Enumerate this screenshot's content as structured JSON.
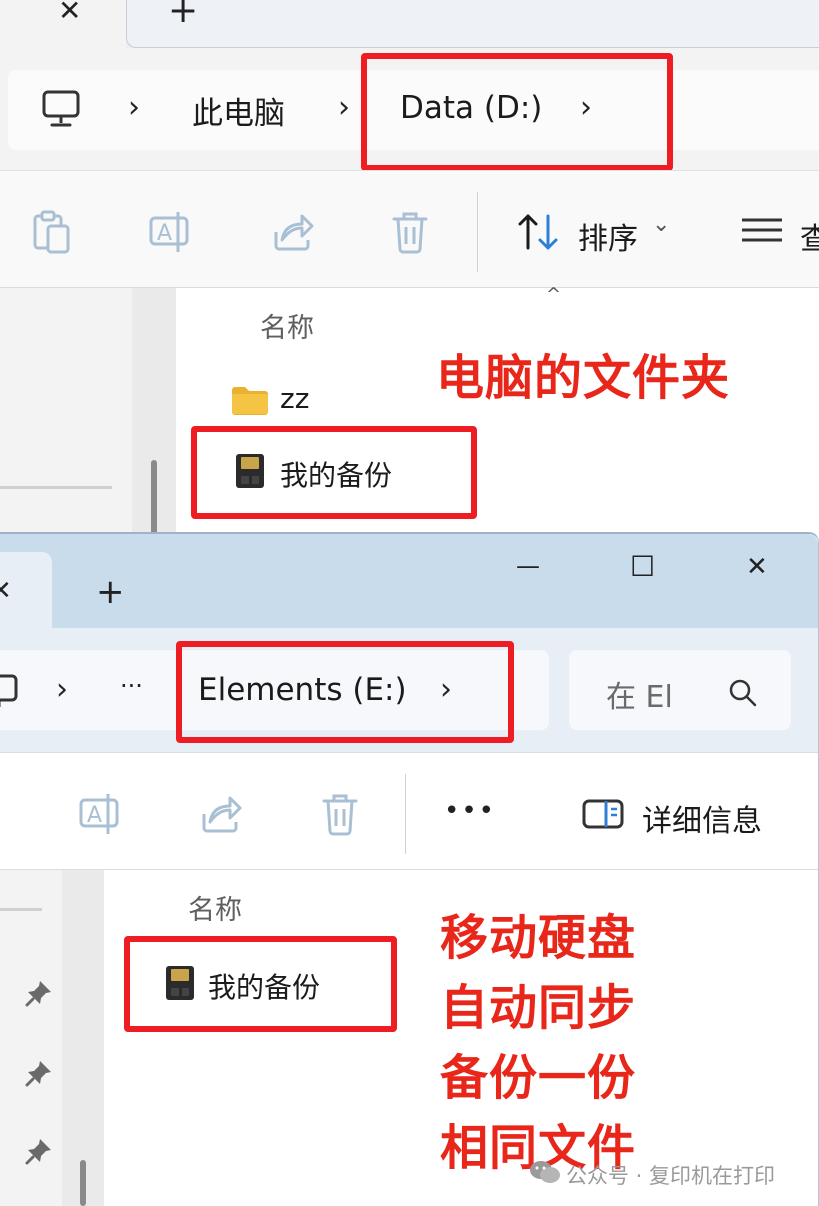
{
  "top_window": {
    "tab_close_glyph": "✕",
    "new_tab_glyph": "+",
    "breadcrumb": {
      "separator": "›",
      "items": [
        "此电脑",
        "Data (D:)"
      ]
    },
    "toolbar": {
      "sort_label": "排序",
      "sort_chevron": "⌄",
      "view_label": "查"
    },
    "column_header": "名称",
    "sort_indicator": "^",
    "files": [
      {
        "name": "zz",
        "type": "folder"
      },
      {
        "name": "我的备份",
        "type": "sd-card"
      }
    ],
    "annotation": "电脑的文件夹"
  },
  "bottom_window": {
    "tab_close_glyph": "✕",
    "new_tab_glyph": "+",
    "window_controls": {
      "minimize": "—",
      "maximize": "☐",
      "close": "✕"
    },
    "breadcrumb": {
      "separator": "›",
      "overflow": "···",
      "items": [
        "Elements (E:)"
      ]
    },
    "search_placeholder": "在 El",
    "toolbar": {
      "more": "•••",
      "details_label": "详细信息"
    },
    "column_header": "名称",
    "files": [
      {
        "name": "我的备份",
        "type": "sd-card"
      }
    ],
    "annotation_lines": [
      "移动硬盘",
      "自动同步",
      "备份一份",
      "相同文件"
    ]
  },
  "watermark": "公众号 · 复印机在打印",
  "colors": {
    "annotation_red": "#e8261a",
    "highlight_box": "#ee1d23",
    "folder_yellow": "#f6c443",
    "tabbar_blue": "#c9dcec"
  }
}
